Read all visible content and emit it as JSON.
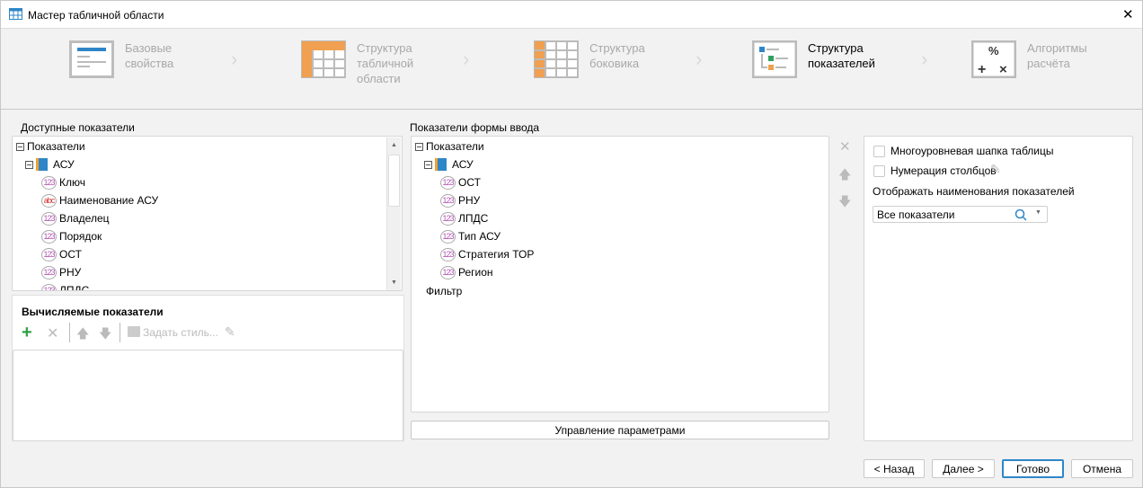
{
  "window": {
    "title": "Мастер табличной области",
    "close": "✕"
  },
  "steps": [
    {
      "label": "Базовые\nсвойства"
    },
    {
      "label": "Структура\nтабличной\nобласти"
    },
    {
      "label": "Структура\nбоковика"
    },
    {
      "label": "Структура\nпоказателей"
    },
    {
      "label": "Алгоритмы\nрасчёта"
    }
  ],
  "left": {
    "title": "Доступные показатели",
    "root": "Показатели",
    "cube": "АСУ",
    "items": [
      {
        "label": "Ключ",
        "type": "123"
      },
      {
        "label": "Наименование АСУ",
        "type": "abc"
      },
      {
        "label": "Владелец",
        "type": "123"
      },
      {
        "label": "Порядок",
        "type": "123"
      },
      {
        "label": "ОСТ",
        "type": "123"
      },
      {
        "label": "РНУ",
        "type": "123"
      },
      {
        "label": "ЛПДС",
        "type": "123"
      }
    ]
  },
  "calc": {
    "title": "Вычисляемые показатели",
    "set_style": "Задать стиль..."
  },
  "middle": {
    "title": "Показатели формы ввода",
    "root": "Показатели",
    "cube": "АСУ",
    "items": [
      "ОСТ",
      "РНУ",
      "ЛПДС",
      "Тип АСУ",
      "Стратегия ТОР",
      "Регион"
    ],
    "filter": "Фильтр",
    "manage_button": "Управление параметрами"
  },
  "right": {
    "multilevel": "Многоуровневая шапка таблицы",
    "numbering": "Нумерация столбцов",
    "display_label": "Отображать наименования показателей",
    "display_value": "Все показатели"
  },
  "footer": {
    "back": "< Назад",
    "next": "Далее >",
    "done": "Готово",
    "cancel": "Отмена"
  }
}
